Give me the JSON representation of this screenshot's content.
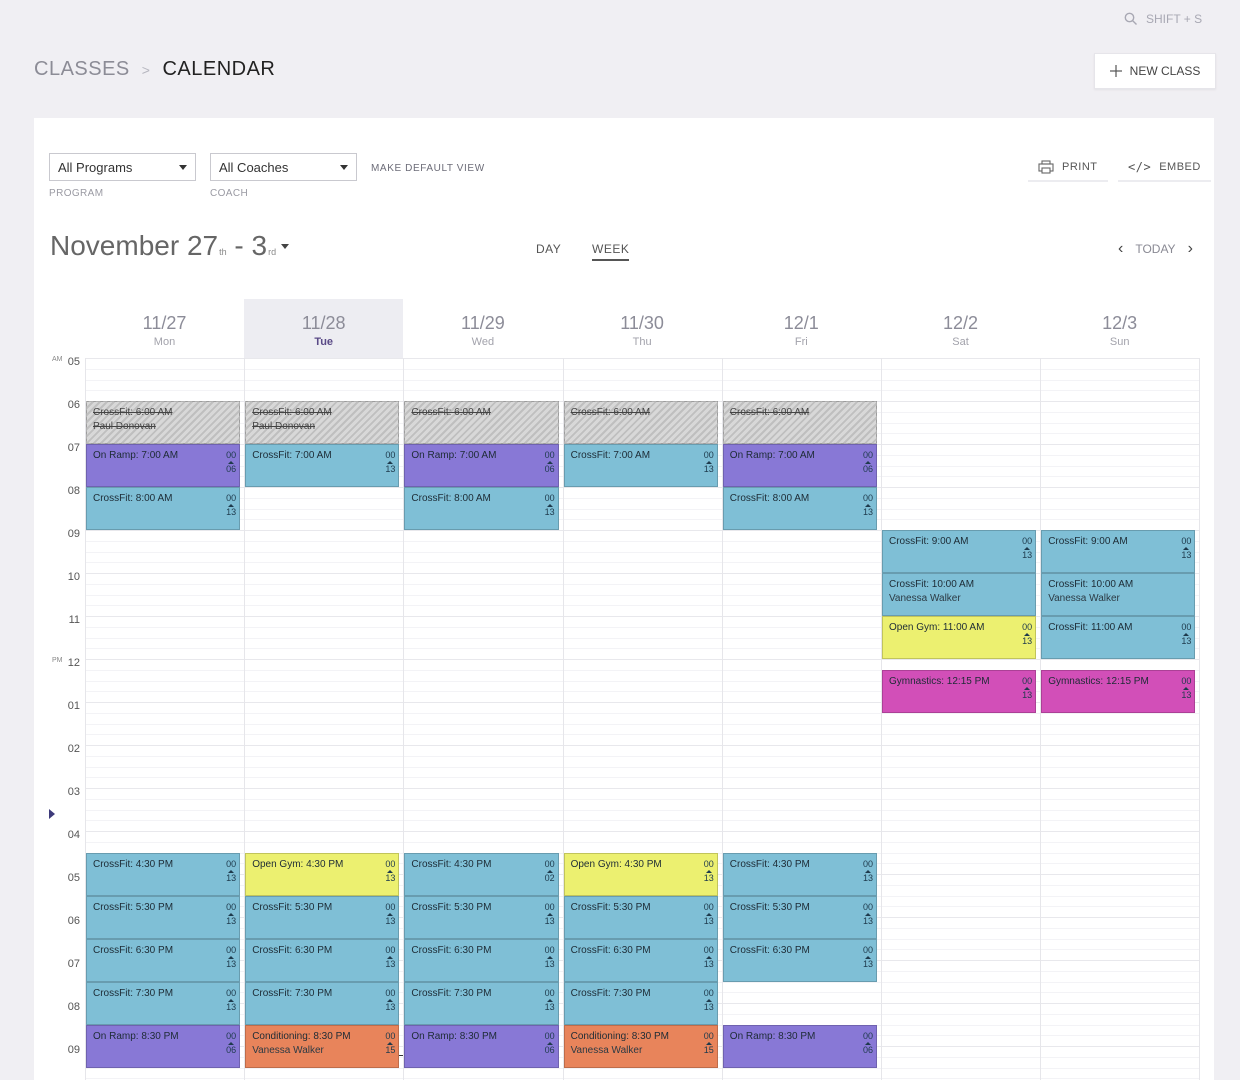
{
  "topbar": {
    "search_hint": "SHIFT + S",
    "search_icon": "search-icon"
  },
  "breadcrumb": {
    "classes": "CLASSES",
    "separator": ">",
    "calendar": "CALENDAR"
  },
  "actions": {
    "new_class_label": "NEW CLASS"
  },
  "filters": {
    "program_value": "All Programs",
    "program_label": "PROGRAM",
    "coach_value": "All Coaches",
    "coach_label": "COACH",
    "make_default": "MAKE DEFAULT VIEW"
  },
  "tools": {
    "print_label": "PRINT",
    "embed_label": "EMBED"
  },
  "range": {
    "start": "November 27",
    "start_suffix": "th",
    "sep": " - ",
    "end": "3",
    "end_suffix": "rd"
  },
  "view_tabs": {
    "day": "DAY",
    "week": "WEEK",
    "active": "week"
  },
  "nav": {
    "today": "TODAY"
  },
  "days": [
    {
      "date": "11/27",
      "name": "Mon",
      "today": false
    },
    {
      "date": "11/28",
      "name": "Tue",
      "today": true
    },
    {
      "date": "11/29",
      "name": "Wed",
      "today": false
    },
    {
      "date": "11/30",
      "name": "Thu",
      "today": false
    },
    {
      "date": "12/1",
      "name": "Fri",
      "today": false
    },
    {
      "date": "12/2",
      "name": "Sat",
      "today": false
    },
    {
      "date": "12/3",
      "name": "Sun",
      "today": false
    }
  ],
  "hours": [
    {
      "label": "05",
      "ampm": "AM"
    },
    {
      "label": "06",
      "ampm": ""
    },
    {
      "label": "07",
      "ampm": ""
    },
    {
      "label": "08",
      "ampm": ""
    },
    {
      "label": "09",
      "ampm": ""
    },
    {
      "label": "10",
      "ampm": ""
    },
    {
      "label": "11",
      "ampm": ""
    },
    {
      "label": "12",
      "ampm": "PM"
    },
    {
      "label": "01",
      "ampm": ""
    },
    {
      "label": "02",
      "ampm": ""
    },
    {
      "label": "03",
      "ampm": ""
    },
    {
      "label": "04",
      "ampm": ""
    },
    {
      "label": "05",
      "ampm": ""
    },
    {
      "label": "06",
      "ampm": ""
    },
    {
      "label": "07",
      "ampm": ""
    },
    {
      "label": "08",
      "ampm": ""
    },
    {
      "label": "09",
      "ampm": ""
    }
  ],
  "colors": {
    "blue": "#7fbfd6",
    "purple": "#8878d6",
    "yellow": "#ecf070",
    "magenta": "#d24fb8",
    "orange": "#e8845b"
  },
  "events": [
    {
      "day": 0,
      "start": 6,
      "title": "CrossFit: 6:00 AM",
      "coach": "Paul Donovan",
      "cancelled": true
    },
    {
      "day": 1,
      "start": 6,
      "title": "CrossFit: 6:00 AM",
      "coach": "Paul Donovan",
      "cancelled": true
    },
    {
      "day": 2,
      "start": 6,
      "title": "CrossFit: 6:00 AM",
      "cancelled": true
    },
    {
      "day": 3,
      "start": 6,
      "title": "CrossFit: 6:00 AM",
      "cancelled": true
    },
    {
      "day": 4,
      "start": 6,
      "title": "CrossFit: 6:00 AM",
      "cancelled": true
    },
    {
      "day": 0,
      "start": 7,
      "title": "On Ramp: 7:00 AM",
      "color": "purple",
      "reserved": "00",
      "capacity": "06"
    },
    {
      "day": 1,
      "start": 7,
      "title": "CrossFit: 7:00 AM",
      "color": "blue",
      "reserved": "00",
      "capacity": "13"
    },
    {
      "day": 2,
      "start": 7,
      "title": "On Ramp: 7:00 AM",
      "color": "purple",
      "reserved": "00",
      "capacity": "06"
    },
    {
      "day": 3,
      "start": 7,
      "title": "CrossFit: 7:00 AM",
      "color": "blue",
      "reserved": "00",
      "capacity": "13"
    },
    {
      "day": 4,
      "start": 7,
      "title": "On Ramp: 7:00 AM",
      "color": "purple",
      "reserved": "00",
      "capacity": "06"
    },
    {
      "day": 0,
      "start": 8,
      "title": "CrossFit: 8:00 AM",
      "color": "blue",
      "reserved": "00",
      "capacity": "13"
    },
    {
      "day": 2,
      "start": 8,
      "title": "CrossFit: 8:00 AM",
      "color": "blue",
      "reserved": "00",
      "capacity": "13"
    },
    {
      "day": 4,
      "start": 8,
      "title": "CrossFit: 8:00 AM",
      "color": "blue",
      "reserved": "00",
      "capacity": "13"
    },
    {
      "day": 5,
      "start": 9,
      "title": "CrossFit: 9:00 AM",
      "color": "blue",
      "reserved": "00",
      "capacity": "13"
    },
    {
      "day": 6,
      "start": 9,
      "title": "CrossFit: 9:00 AM",
      "color": "blue",
      "reserved": "00",
      "capacity": "13"
    },
    {
      "day": 5,
      "start": 10,
      "title": "CrossFit: 10:00 AM",
      "coach": "Vanessa Walker",
      "color": "blue"
    },
    {
      "day": 6,
      "start": 10,
      "title": "CrossFit: 10:00 AM",
      "coach": "Vanessa Walker",
      "color": "blue"
    },
    {
      "day": 5,
      "start": 11,
      "title": "Open Gym: 11:00 AM",
      "color": "yellow",
      "reserved": "00",
      "capacity": "13"
    },
    {
      "day": 6,
      "start": 11,
      "title": "CrossFit: 11:00 AM",
      "color": "blue",
      "reserved": "00",
      "capacity": "13"
    },
    {
      "day": 5,
      "start": 12.25,
      "title": "Gymnastics: 12:15 PM",
      "color": "magenta",
      "reserved": "00",
      "capacity": "13"
    },
    {
      "day": 6,
      "start": 12.25,
      "title": "Gymnastics: 12:15 PM",
      "color": "magenta",
      "reserved": "00",
      "capacity": "13"
    },
    {
      "day": 0,
      "start": 16.5,
      "title": "CrossFit: 4:30 PM",
      "color": "blue",
      "reserved": "00",
      "capacity": "13"
    },
    {
      "day": 1,
      "start": 16.5,
      "title": "Open Gym: 4:30 PM",
      "color": "yellow",
      "reserved": "00",
      "capacity": "13"
    },
    {
      "day": 2,
      "start": 16.5,
      "title": "CrossFit: 4:30 PM",
      "color": "blue",
      "reserved": "00",
      "capacity": "02"
    },
    {
      "day": 3,
      "start": 16.5,
      "title": "Open Gym: 4:30 PM",
      "color": "yellow",
      "reserved": "00",
      "capacity": "13"
    },
    {
      "day": 4,
      "start": 16.5,
      "title": "CrossFit: 4:30 PM",
      "color": "blue",
      "reserved": "00",
      "capacity": "13"
    },
    {
      "day": 0,
      "start": 17.5,
      "title": "CrossFit: 5:30 PM",
      "color": "blue",
      "reserved": "00",
      "capacity": "13"
    },
    {
      "day": 1,
      "start": 17.5,
      "title": "CrossFit: 5:30 PM",
      "color": "blue",
      "reserved": "00",
      "capacity": "13"
    },
    {
      "day": 2,
      "start": 17.5,
      "title": "CrossFit: 5:30 PM",
      "color": "blue",
      "reserved": "00",
      "capacity": "13"
    },
    {
      "day": 3,
      "start": 17.5,
      "title": "CrossFit: 5:30 PM",
      "color": "blue",
      "reserved": "00",
      "capacity": "13"
    },
    {
      "day": 4,
      "start": 17.5,
      "title": "CrossFit: 5:30 PM",
      "color": "blue",
      "reserved": "00",
      "capacity": "13"
    },
    {
      "day": 0,
      "start": 18.5,
      "title": "CrossFit: 6:30 PM",
      "color": "blue",
      "reserved": "00",
      "capacity": "13"
    },
    {
      "day": 1,
      "start": 18.5,
      "title": "CrossFit: 6:30 PM",
      "color": "blue",
      "reserved": "00",
      "capacity": "13"
    },
    {
      "day": 2,
      "start": 18.5,
      "title": "CrossFit: 6:30 PM",
      "color": "blue",
      "reserved": "00",
      "capacity": "13"
    },
    {
      "day": 3,
      "start": 18.5,
      "title": "CrossFit: 6:30 PM",
      "color": "blue",
      "reserved": "00",
      "capacity": "13"
    },
    {
      "day": 4,
      "start": 18.5,
      "title": "CrossFit: 6:30 PM",
      "color": "blue",
      "reserved": "00",
      "capacity": "13"
    },
    {
      "day": 0,
      "start": 19.5,
      "title": "CrossFit: 7:30 PM",
      "color": "blue",
      "reserved": "00",
      "capacity": "13"
    },
    {
      "day": 1,
      "start": 19.5,
      "title": "CrossFit: 7:30 PM",
      "color": "blue",
      "reserved": "00",
      "capacity": "13"
    },
    {
      "day": 2,
      "start": 19.5,
      "title": "CrossFit: 7:30 PM",
      "color": "blue",
      "reserved": "00",
      "capacity": "13"
    },
    {
      "day": 3,
      "start": 19.5,
      "title": "CrossFit: 7:30 PM",
      "color": "blue",
      "reserved": "00",
      "capacity": "13"
    },
    {
      "day": 0,
      "start": 20.5,
      "title": "On Ramp: 8:30 PM",
      "color": "purple",
      "reserved": "00",
      "capacity": "06"
    },
    {
      "day": 1,
      "start": 20.5,
      "title": "Conditioning: 8:30 PM",
      "coach": "Vanessa Walker",
      "color": "orange",
      "reserved": "00",
      "capacity": "15"
    },
    {
      "day": 2,
      "start": 20.5,
      "title": "On Ramp: 8:30 PM",
      "color": "purple",
      "reserved": "00",
      "capacity": "06"
    },
    {
      "day": 3,
      "start": 20.5,
      "title": "Conditioning: 8:30 PM",
      "coach": "Vanessa Walker",
      "color": "orange",
      "reserved": "00",
      "capacity": "15"
    },
    {
      "day": 4,
      "start": 20.5,
      "title": "On Ramp: 8:30 PM",
      "color": "purple",
      "reserved": "00",
      "capacity": "06"
    }
  ]
}
